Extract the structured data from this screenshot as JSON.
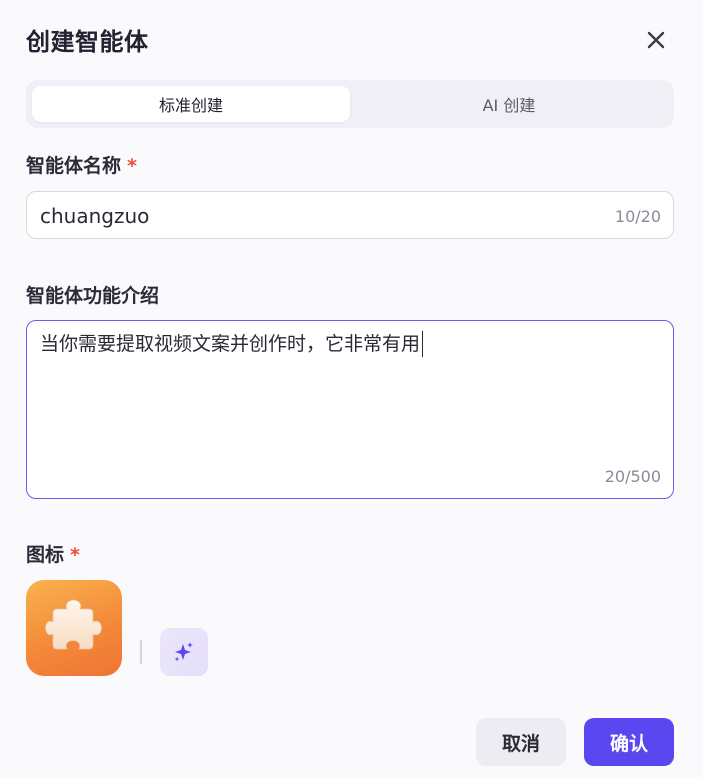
{
  "dialog": {
    "title": "创建智能体",
    "close_icon": "close-icon"
  },
  "tabs": [
    {
      "label": "标准创建",
      "active": true
    },
    {
      "label": "AI 创建",
      "active": false
    }
  ],
  "name_field": {
    "label": "智能体名称",
    "required_mark": "*",
    "value": "chuangzuo",
    "counter": "10/20"
  },
  "description_field": {
    "label": "智能体功能介绍",
    "value": "当你需要提取视频文案并创作时，它非常有用",
    "counter": "20/500"
  },
  "icon_field": {
    "label": "图标",
    "required_mark": "*",
    "selected_icon": "puzzle-piece-icon",
    "ai_generate_icon": "sparkle-icon"
  },
  "footer": {
    "cancel_label": "取消",
    "confirm_label": "确认"
  },
  "colors": {
    "accent": "#5a47f0",
    "required": "#f04a3a",
    "icon_gradient_start": "#f9b24e",
    "icon_gradient_end": "#ee7434"
  }
}
